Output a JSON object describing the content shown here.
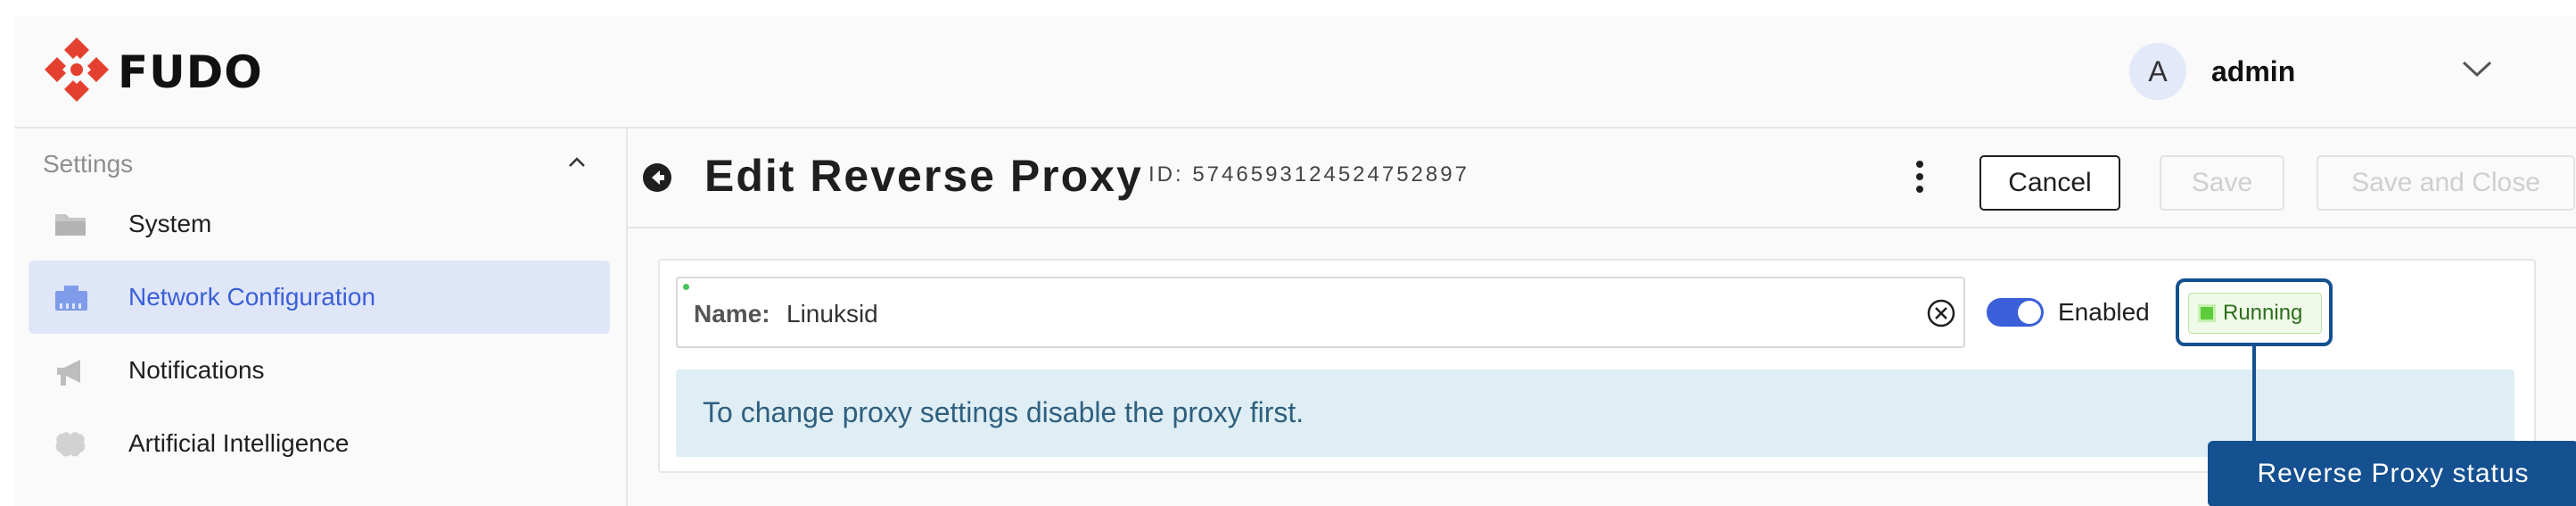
{
  "app": {
    "brand": "FUDO"
  },
  "header": {
    "user": {
      "avatar_initial": "A",
      "name": "admin"
    }
  },
  "sidebar": {
    "section_title": "Settings",
    "items": [
      {
        "label": "System",
        "icon": "folder-icon",
        "active": false
      },
      {
        "label": "Network Configuration",
        "icon": "network-icon",
        "active": true
      },
      {
        "label": "Notifications",
        "icon": "megaphone-icon",
        "active": false
      },
      {
        "label": "Artificial Intelligence",
        "icon": "brain-icon",
        "active": false
      }
    ]
  },
  "page": {
    "title": "Edit Reverse Proxy",
    "id_text": "ID: 5746593124524752897",
    "buttons": {
      "cancel": "Cancel",
      "save": "Save",
      "save_close": "Save and Close"
    }
  },
  "form": {
    "name_label": "Name:",
    "name_value": "Linuksid",
    "enabled_label": "Enabled",
    "enabled": true,
    "status": "Running",
    "info_message": "To change proxy settings disable the proxy first."
  },
  "annotation": {
    "label": "Reverse Proxy status"
  },
  "colors": {
    "accent": "#3a5fd8",
    "brand_red": "#e4402f",
    "callout": "#155090",
    "status_green": "#5dcc3b",
    "info_bg": "#dfeef5"
  }
}
